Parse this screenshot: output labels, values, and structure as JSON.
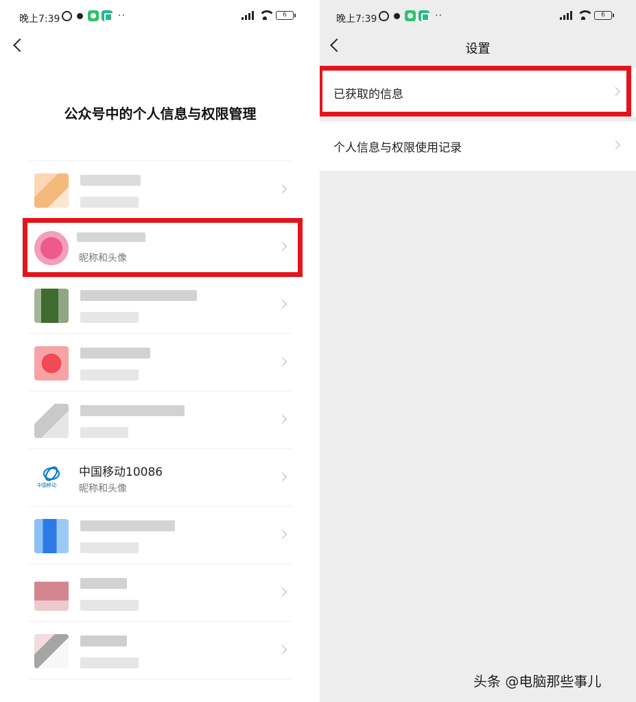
{
  "left": {
    "status": {
      "time": "晚上7:39",
      "battery": "6",
      "more": "··"
    },
    "title": "公众号中的个人信息与权限管理",
    "items": [
      {
        "name": "",
        "sub": "",
        "avatar": "av-orange"
      },
      {
        "name": "",
        "sub": "昵称和头像",
        "avatar": "av-pink"
      },
      {
        "name": "",
        "sub": "",
        "avatar": "av-green"
      },
      {
        "name": "",
        "sub": "",
        "avatar": "av-red"
      },
      {
        "name": "",
        "sub": "",
        "avatar": "av-gray"
      },
      {
        "name": "中国移动10086",
        "sub": "昵称和头像",
        "avatar": "av-cm",
        "logo_text": "中国移动"
      },
      {
        "name": "",
        "sub": "",
        "avatar": "av-blue"
      },
      {
        "name": "",
        "sub": "",
        "avatar": "av-rose"
      },
      {
        "name": "",
        "sub": "",
        "avatar": "av-mauve"
      }
    ]
  },
  "right": {
    "status": {
      "time": "晚上7:39",
      "battery": "6",
      "more": "··"
    },
    "nav_title": "设置",
    "rows": [
      {
        "label": "已获取的信息"
      },
      {
        "label": "个人信息与权限使用记录"
      }
    ]
  },
  "watermark": "头条 @电脑那些事儿",
  "colors": {
    "highlight": "#e4141c",
    "page_bg": "#ededed",
    "chevron": "#b2b2b2",
    "china_mobile_blue": "#0a6bb5"
  }
}
